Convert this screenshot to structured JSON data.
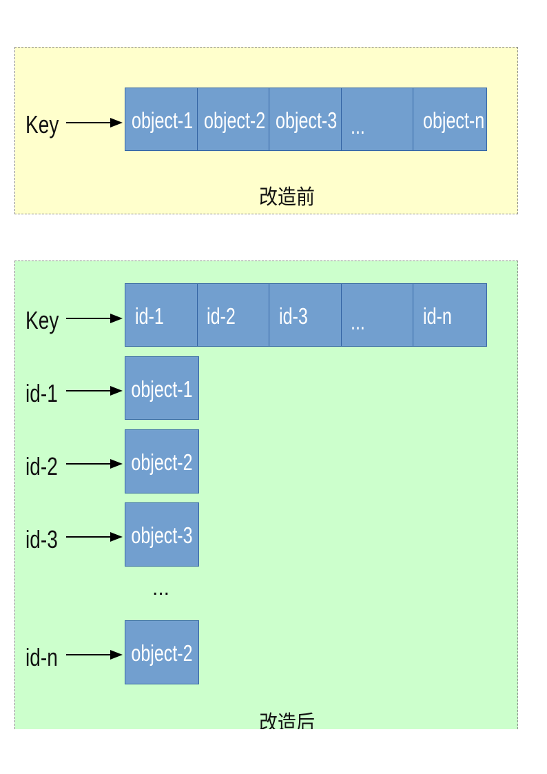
{
  "before": {
    "key_label": "Key",
    "cells": [
      "object-1",
      "object-2",
      "object-3",
      "...",
      "object-n"
    ],
    "caption": "改造前"
  },
  "after": {
    "key_label": "Key",
    "cells": [
      "id-1",
      "id-2",
      "id-3",
      "...",
      "id-n"
    ],
    "rows": [
      {
        "id": "id-1",
        "object": "object-1"
      },
      {
        "id": "id-2",
        "object": "object-2"
      },
      {
        "id": "id-3",
        "object": "object-3"
      },
      {
        "id": "id-n",
        "object": "object-2"
      }
    ],
    "ellipsis": "...",
    "caption": "改造后"
  },
  "colors": {
    "before_background": "#ffffcc",
    "after_background": "#ccffcc",
    "cell_fill": "#729fcf",
    "cell_border": "#3465a4"
  }
}
